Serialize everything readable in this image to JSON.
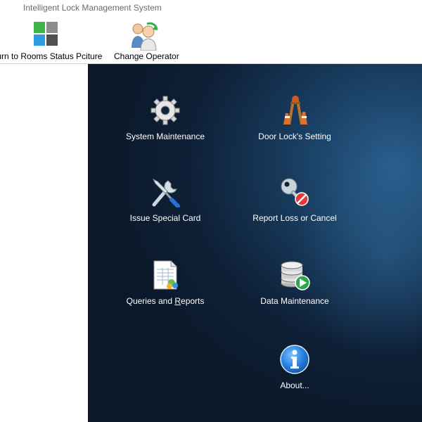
{
  "window": {
    "title": "Intelligent Lock Management System"
  },
  "toolbar": {
    "rooms_label": "turn to Rooms Status Pciture",
    "operator_label": "Change Operator"
  },
  "modules": {
    "system_maintenance": "System Maintenance",
    "door_lock_setting": "Door Lock's Setting",
    "issue_special_card": "Issue Special Card",
    "report_loss_or_cancel": "Report Loss or Cancel",
    "queries_prefix": "Queries and ",
    "queries_underlined": "R",
    "queries_suffix": "eports",
    "data_maintenance": "Data Maintenance",
    "about": "About..."
  },
  "icons": {
    "rooms": "rooms-status-grid-icon",
    "operator": "change-operator-icon",
    "system_maintenance": "gear-icon",
    "door_lock_setting": "door-lock-setting-icon",
    "issue_special_card": "wrench-screwdriver-icon",
    "report_loss_or_cancel": "key-cancel-icon",
    "queries_and_reports": "report-document-icon",
    "data_maintenance": "database-icon",
    "about": "info-icon"
  },
  "colors": {
    "panel_dark": "#0e2037",
    "panel_light": "#2a5d8c",
    "grid_green": "#3cb44a",
    "grid_gray": "#8c8c8c",
    "grid_blue": "#2f9ae0",
    "grid_dark": "#505050"
  }
}
